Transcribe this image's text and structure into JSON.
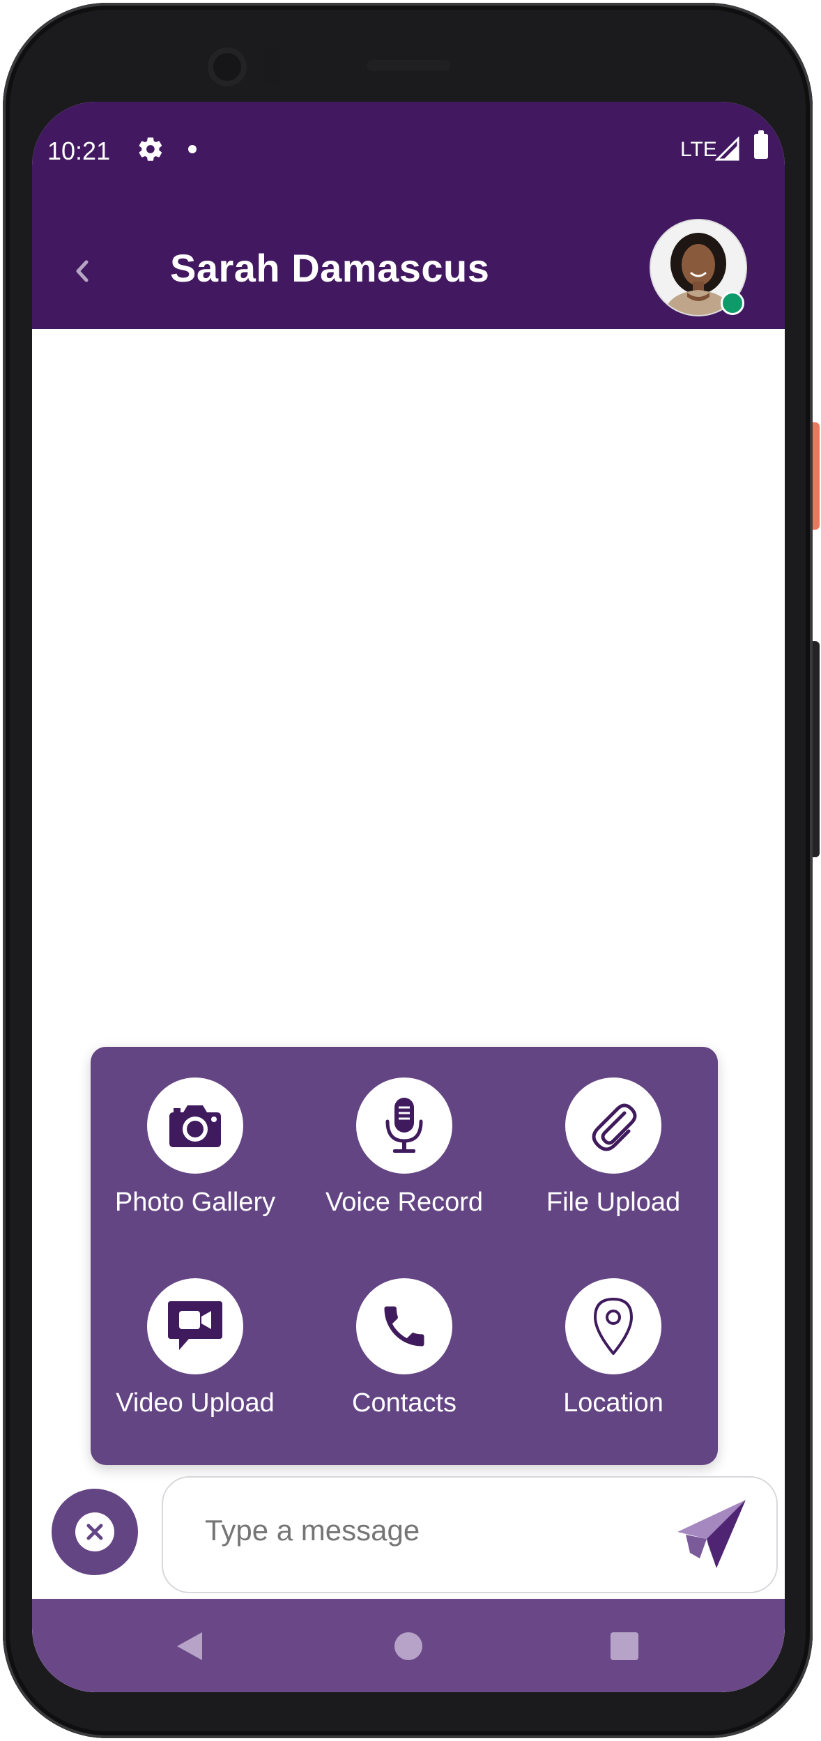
{
  "status_bar": {
    "time": "10:21",
    "network": "LTE"
  },
  "header": {
    "contact_name": "Sarah Damascus",
    "online": true
  },
  "attach_menu": {
    "items": [
      {
        "label": "Photo Gallery",
        "icon": "camera-icon"
      },
      {
        "label": "Voice Record",
        "icon": "microphone-icon"
      },
      {
        "label": "File Upload",
        "icon": "paperclip-icon"
      },
      {
        "label": "Video Upload",
        "icon": "video-message-icon"
      },
      {
        "label": "Contacts",
        "icon": "phone-icon"
      },
      {
        "label": "Location",
        "icon": "location-pin-icon"
      }
    ]
  },
  "composer": {
    "placeholder": "Type a message",
    "value": ""
  },
  "colors": {
    "header": "#421860",
    "panel": "#644584",
    "icon": "#3f1a5c",
    "online": "#0f9a6a",
    "navbar": "#6a4888"
  }
}
